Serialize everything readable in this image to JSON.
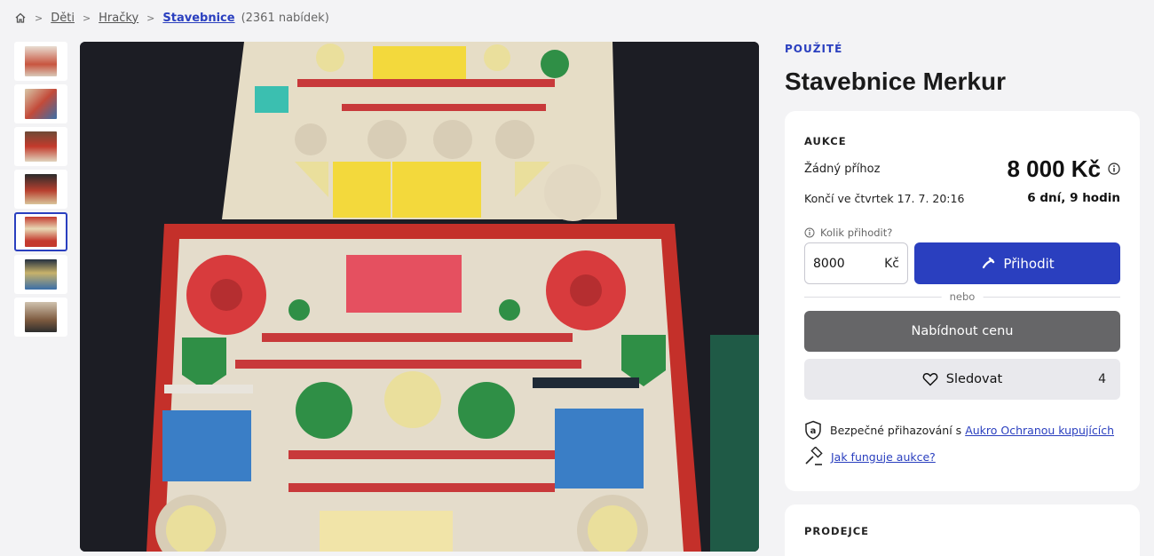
{
  "breadcrumb": {
    "home_icon": "home-icon",
    "items": [
      "Děti",
      "Hračky"
    ],
    "current": "Stavebnice",
    "count": "(2361 nabídek)"
  },
  "gallery": {
    "thumbnails": [
      {
        "color": "#d9c9b8"
      },
      {
        "color": "#c9b79e"
      },
      {
        "color": "#b94a3d"
      },
      {
        "color": "#6b4a3a"
      },
      {
        "color": "#c43a2e",
        "active": true
      },
      {
        "color": "#2e3a4a"
      },
      {
        "color": "#8a7a66"
      }
    ]
  },
  "listing": {
    "condition": "POUŽITÉ",
    "title": "Stavebnice Merkur"
  },
  "auction": {
    "label": "AUKCE",
    "no_bid": "Žádný příhoz",
    "price": "8 000 Kč",
    "ends": "Končí ve čtvrtek 17. 7. 20:16",
    "remaining": "6 dní, 9 hodin",
    "bid_question": "Kolik přihodit?",
    "bid_value": "8000",
    "currency": "Kč",
    "bid_button": "Přihodit",
    "or": "nebo",
    "offer_button": "Nabídnout cenu",
    "watch_button": "Sledovat",
    "watch_count": "4",
    "safe_text": "Bezpečné přihazování s",
    "safe_link": "Aukro Ochranou kupujících",
    "how_link": "Jak funguje aukce?"
  },
  "seller": {
    "label": "PRODEJCE"
  },
  "colors": {
    "accent": "#2a3fbf",
    "offer_button": "#666668",
    "watch_button": "#e9e9ed"
  }
}
